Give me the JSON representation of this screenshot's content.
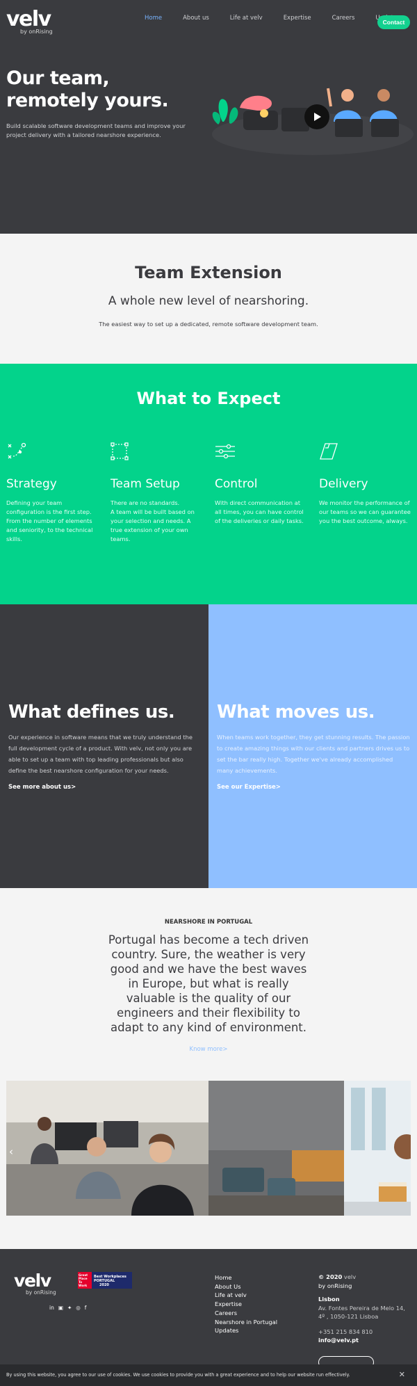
{
  "header": {
    "logo": "velv",
    "logo_sub": "by onRising",
    "nav": [
      "Home",
      "About us",
      "Life at velv",
      "Expertise",
      "Careers",
      "Updates"
    ],
    "active_nav": "Home",
    "contact_label": "Contact"
  },
  "hero": {
    "title_line1": "Our team,",
    "title_line2": "remotely yours.",
    "text": "Build scalable software development teams and improve your project delivery with a tailored nearshore experience."
  },
  "team_extension": {
    "title": "Team Extension",
    "subtitle": "A whole new level of nearshoring.",
    "text": "The easiest way to set up a dedicated, remote software development team."
  },
  "expect": {
    "title": "What to Expect",
    "features": [
      {
        "title": "Strategy",
        "text": "Defining your team configuration is the first step. From the number of elements and seniority, to the technical skills.",
        "icon": "strategy-icon"
      },
      {
        "title": "Team Setup",
        "text": "There are no standards.\nA team will be built based on your selection and needs. A true extension of your own teams.",
        "icon": "team-setup-icon"
      },
      {
        "title": "Control",
        "text": "With direct communication at all times, you can have control of the deliveries or daily tasks.",
        "icon": "control-icon"
      },
      {
        "title": "Delivery",
        "text": "We monitor the performance of our teams so we can guarantee you the best outcome, always.",
        "icon": "delivery-icon"
      }
    ]
  },
  "defines": {
    "title": "What defines us.",
    "text": "Our experience in software means that we truly understand the full development cycle of a product. With velv, not only you are able to set up a team with top leading professionals but also define the best nearshore configuration for your needs.",
    "link": "See more about us>"
  },
  "moves": {
    "title": "What moves us.",
    "text": "When teams work together, they get stunning results. The passion to create amazing things with our clients and partners drives us to set the bar really high. Together we've already accomplished many achievements.",
    "link": "See our Expertise>"
  },
  "nearshore": {
    "label": "NEARSHORE IN PORTUGAL",
    "quote": "Portugal has become a tech driven country.  Sure, the weather is very good and we have the best waves in Europe, but what is really valuable is the quality of our engineers and their flexibility to adapt to any kind of environment.",
    "link": "Know more>"
  },
  "footer": {
    "logo": "velv",
    "logo_sub": "by onRising",
    "badge_left": "Great Place To Work",
    "badge_right": "Best Workplaces",
    "badge_right_sub": "PORTUGAL",
    "badge_year": "2020",
    "links": [
      "Home",
      "About Us",
      "Life at velv",
      "Expertise",
      "Careers",
      "Nearshore in Portugal",
      "Updates"
    ],
    "copyright_year": "© 2020",
    "copyright_brand": " velv",
    "copyright_sub": "by onRising",
    "city": "Lisbon",
    "address_line1": "Av. Fontes Pereira de Melo 14,",
    "address_line2": "4º , 1050-121 Lisboa",
    "phone": "+351 215 834 810",
    "email": "info@velv.pt"
  },
  "cookie": {
    "text": "By using this website, you agree to our use of cookies. We use cookies to provide you with a great experience and to help our website run effectively."
  },
  "colors": {
    "dark": "#3a3b3f",
    "green": "#03d38b",
    "blue": "#8fbfff",
    "contact": "#13d18f",
    "nav_active": "#79b4ff"
  }
}
